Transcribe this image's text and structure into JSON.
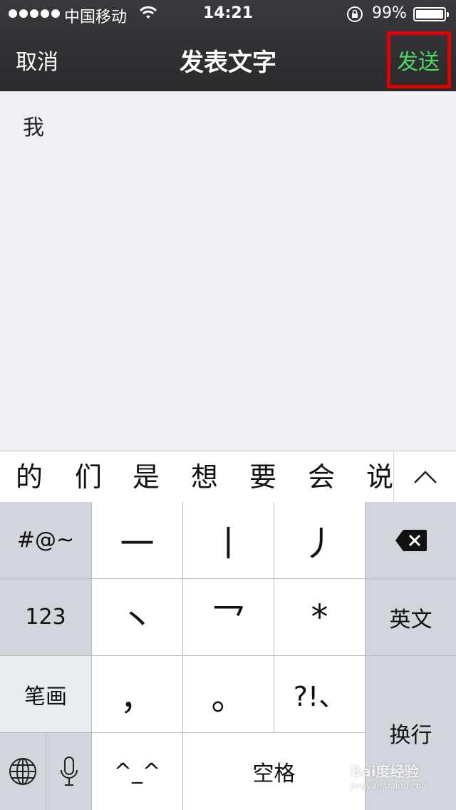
{
  "status_bar": {
    "carrier": "中国移动",
    "time": "14:21",
    "battery": "99%"
  },
  "nav": {
    "cancel_label": "取消",
    "title": "发表文字",
    "send_label": "发送",
    "send_color": "#4cd964"
  },
  "composer": {
    "text": "我"
  },
  "candidates": [
    "的",
    "们",
    "是",
    "想",
    "要",
    "会",
    "说"
  ],
  "keyboard": {
    "symbols": "#@~",
    "numbers": "123",
    "stroke": "笔画",
    "english": "英文",
    "k1": "一",
    "k2": "丨",
    "k3": "丿",
    "k4": "丶",
    "k5": "乛",
    "k6": "*",
    "k7": "，",
    "k8": "。",
    "k9": "?!、",
    "emoticon": "^_^",
    "space": "空格",
    "return": "换行"
  },
  "watermark": {
    "brand": "Bai度经验",
    "url": "jingyan.baidu.com"
  }
}
